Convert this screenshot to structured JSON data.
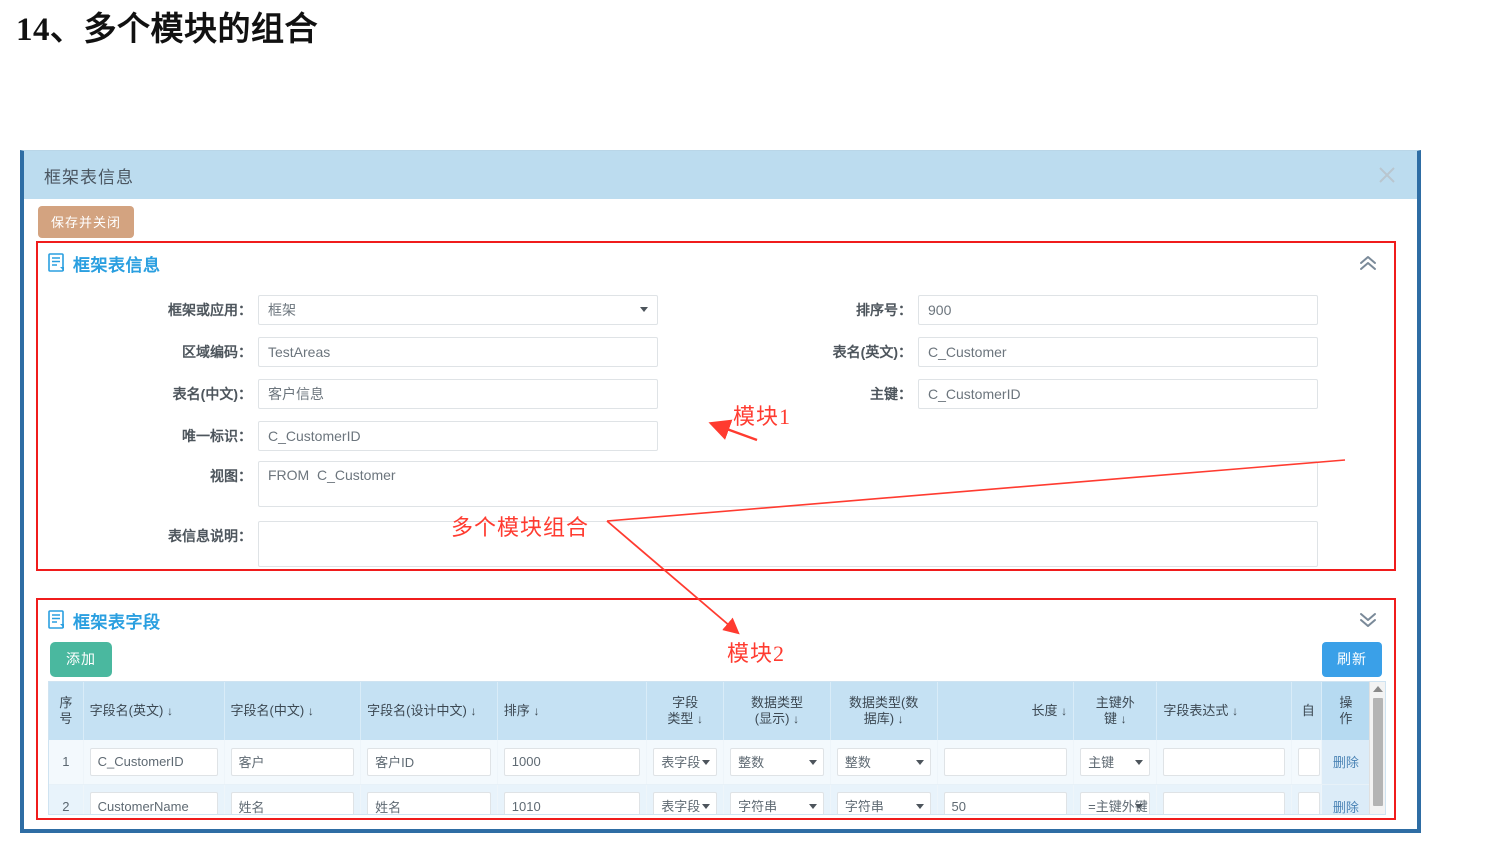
{
  "page": {
    "title": "14、多个模块的组合"
  },
  "dialog": {
    "title": "框架表信息",
    "close_icon": "close-icon",
    "save_label": "保存并关闭"
  },
  "module1": {
    "section_title": "框架表信息",
    "section_icon": "document-icon",
    "collapse_icon": "chevron-double-up-icon",
    "fields_left": [
      {
        "label": "框架或应用：",
        "value": "框架",
        "type": "select"
      },
      {
        "label": "区域编码：",
        "value": "TestAreas",
        "type": "text"
      },
      {
        "label": "表名(中文)：",
        "value": "客户信息",
        "type": "text"
      },
      {
        "label": "唯一标识：",
        "value": "C_CustomerID",
        "type": "text"
      },
      {
        "label": "视图：",
        "value": "FROM  C_Customer",
        "type": "textarea"
      },
      {
        "label": "表信息说明：",
        "value": "",
        "type": "textarea"
      }
    ],
    "fields_right": [
      {
        "label": "排序号：",
        "value": "900",
        "type": "text"
      },
      {
        "label": "表名(英文)：",
        "value": "C_Customer",
        "type": "text"
      },
      {
        "label": "主键：",
        "value": "C_CustomerID",
        "type": "text"
      }
    ]
  },
  "module2": {
    "section_title": "框架表字段",
    "section_icon": "document-icon",
    "collapse_icon": "chevron-double-down-icon",
    "add_label": "添加",
    "refresh_label": "刷新",
    "columns": [
      {
        "key": "seq",
        "label": "序\n号",
        "sortable": false
      },
      {
        "key": "name_en",
        "label": "字段名(英文)",
        "sortable": true
      },
      {
        "key": "name_cn",
        "label": "字段名(中文)",
        "sortable": true
      },
      {
        "key": "name_dz",
        "label": "字段名(设计中文)",
        "sortable": true
      },
      {
        "key": "order",
        "label": "排序",
        "sortable": true
      },
      {
        "key": "ftype",
        "label": "字段\n类型",
        "sortable": true
      },
      {
        "key": "dtype_s",
        "label": "数据类型\n(显示)",
        "sortable": true
      },
      {
        "key": "dtype_d",
        "label": "数据类型(数\n据库)",
        "sortable": true
      },
      {
        "key": "length",
        "label": "长度",
        "sortable": true
      },
      {
        "key": "pkfk",
        "label": "主键外\n键",
        "sortable": true
      },
      {
        "key": "expr",
        "label": "字段表达式",
        "sortable": true
      },
      {
        "key": "auto",
        "label": "自",
        "sortable": false
      },
      {
        "key": "op",
        "label": "操\n作",
        "sortable": false
      }
    ],
    "rows": [
      {
        "seq": "1",
        "name_en": "C_CustomerID",
        "name_cn": "客户",
        "name_dz": "客户ID",
        "order": "1000",
        "ftype": "表字段",
        "dtype_s": "整数",
        "dtype_d": "整数",
        "length": "",
        "pkfk": "主键",
        "expr": "",
        "auto": "",
        "op": "删除"
      },
      {
        "seq": "2",
        "name_en": "CustomerName",
        "name_cn": "姓名",
        "name_dz": "姓名",
        "order": "1010",
        "ftype": "表字段",
        "dtype_s": "字符串",
        "dtype_d": "字符串",
        "length": "50",
        "pkfk": "=主键外键",
        "expr": "",
        "auto": "",
        "op": "删除"
      }
    ]
  },
  "annotations": {
    "module1_label": "模块1",
    "module2_label": "模块2",
    "combo_label": "多个模块组合"
  },
  "colors": {
    "dialog_header": "#bcdcef",
    "dialog_border": "#2e6da4",
    "section_title": "#2a9fe0",
    "save_button": "#d3a380",
    "add_button": "#4ab89f",
    "refresh_button": "#3aa0e8",
    "annotation_red": "#ff3b30",
    "module_outline": "#f01c1c",
    "grid_header": "#c5e1f3"
  }
}
